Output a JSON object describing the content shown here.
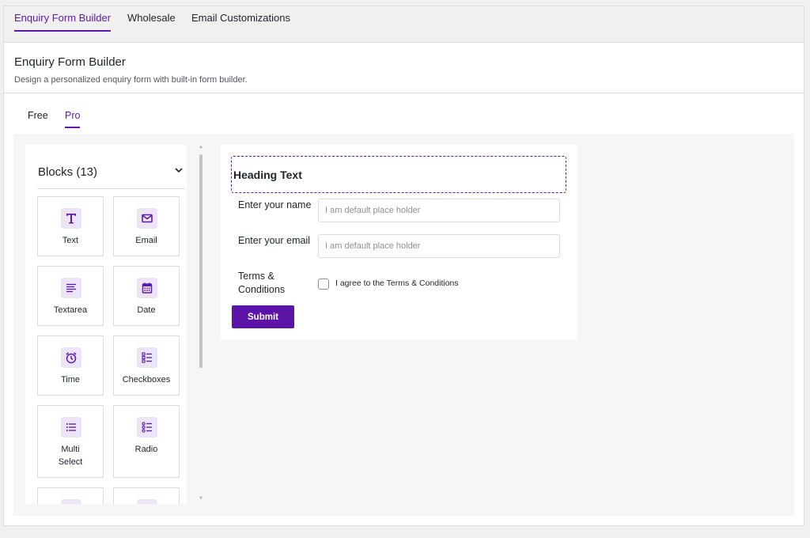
{
  "top_tabs": [
    {
      "label": "Enquiry Form Builder",
      "active": true
    },
    {
      "label": "Wholesale",
      "active": false
    },
    {
      "label": "Email Customizations",
      "active": false
    }
  ],
  "page": {
    "title": "Enquiry Form Builder",
    "description": "Design a personalized enquiry form with built-in form builder."
  },
  "sub_tabs": [
    {
      "label": "Free",
      "active": false
    },
    {
      "label": "Pro",
      "active": true
    }
  ],
  "blocks": {
    "header": "Blocks (13)",
    "items": [
      {
        "label": "Text",
        "icon": "text-icon"
      },
      {
        "label": "Email",
        "icon": "email-icon"
      },
      {
        "label": "Textarea",
        "icon": "textarea-icon"
      },
      {
        "label": "Date",
        "icon": "calendar-icon"
      },
      {
        "label": "Time",
        "icon": "clock-icon"
      },
      {
        "label": "Checkboxes",
        "icon": "checkbox-list-icon"
      },
      {
        "label": "Multi Select",
        "icon": "multi-select-icon"
      },
      {
        "label": "Radio",
        "icon": "radio-list-icon"
      },
      {
        "label": "",
        "icon": "image-icon"
      },
      {
        "label": "",
        "icon": "file-icon"
      }
    ]
  },
  "form": {
    "heading": "Heading Text",
    "fields": [
      {
        "label": "Enter your name",
        "placeholder": "I am default place holder"
      },
      {
        "label": "Enter your email",
        "placeholder": "I am default place holder"
      }
    ],
    "terms_label": "Terms & Conditions",
    "checkbox_label": "I agree to the Terms & Conditions",
    "submit_label": "Submit"
  },
  "colors": {
    "accent": "#5b1aa8",
    "icon_bg": "#ede4f8",
    "button": "#5b13a8"
  }
}
